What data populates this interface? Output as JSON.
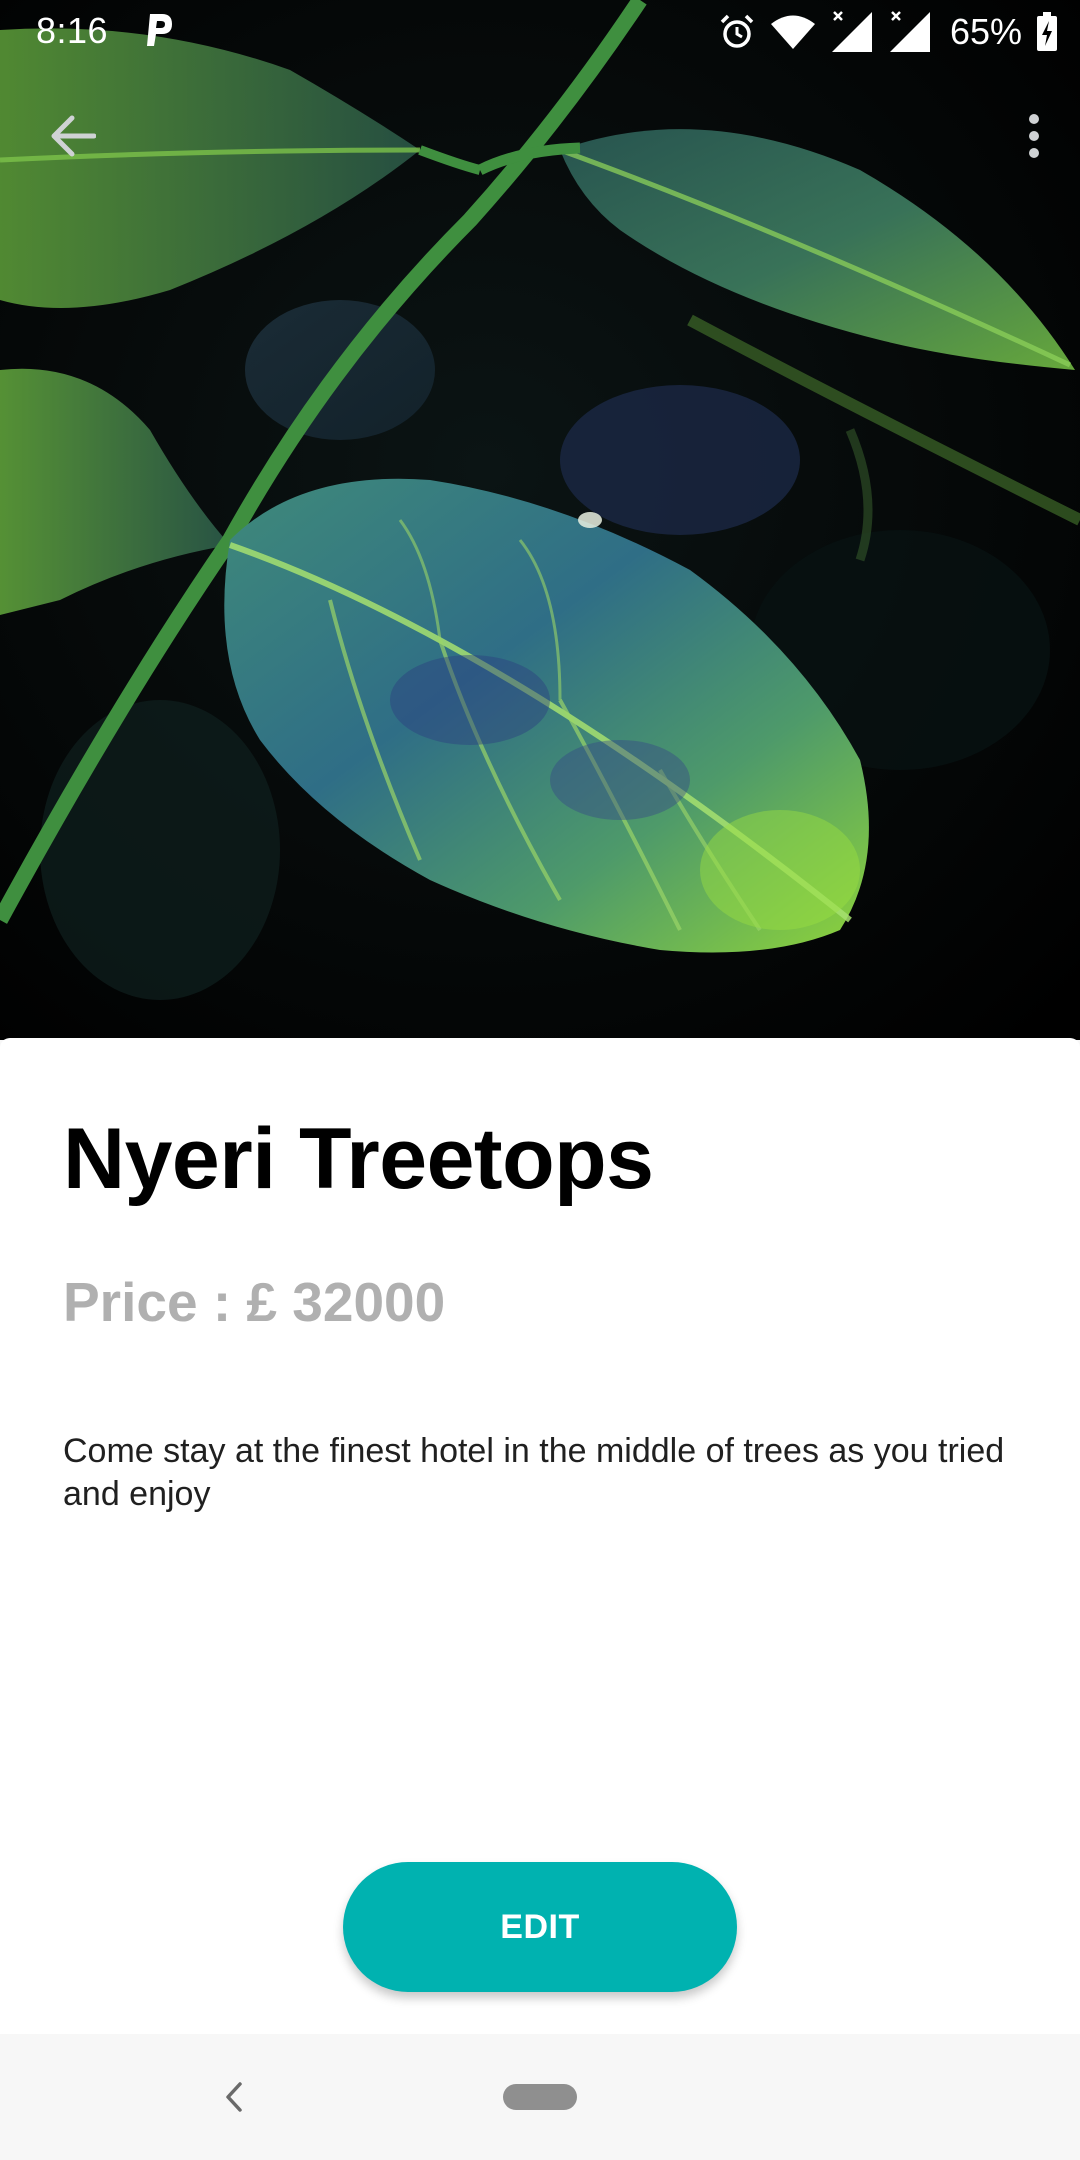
{
  "status_bar": {
    "time": "8:16",
    "battery": "65%",
    "icons": [
      "parking-app-icon",
      "alarm-icon",
      "wifi-icon",
      "signal-icon",
      "signal-icon",
      "battery-charging-icon"
    ]
  },
  "app_bar": {
    "back_icon": "arrow-back-icon",
    "menu_icon": "more-vert-icon"
  },
  "hero_image": {
    "subject": "green leaves against dark background"
  },
  "listing": {
    "title": "Nyeri Treetops",
    "price": "Price : £ 32000",
    "description": "Come stay at the finest hotel in the middle of trees as you tried and enjoy"
  },
  "actions": {
    "edit_label": "EDIT"
  },
  "colors": {
    "accent": "#00b2b0",
    "price_text": "#b0b0b0",
    "title_text": "#000000"
  }
}
